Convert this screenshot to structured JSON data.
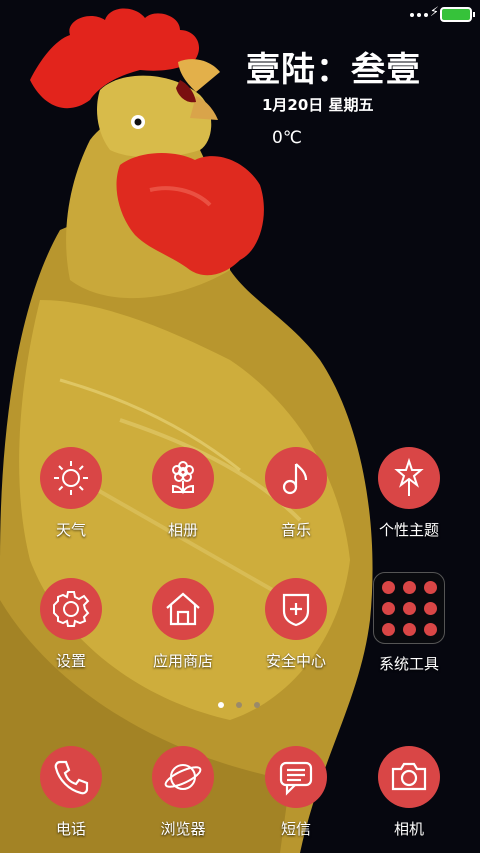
{
  "status_bar": {
    "signal_icon": "signal-dots-icon",
    "charging_icon": "charging-bolt-icon",
    "battery_icon": "battery-icon",
    "battery_color": "#36c23a"
  },
  "clock_widget": {
    "time": "壹陆：叁壹",
    "date": "1月20日  星期五",
    "temperature": "0℃"
  },
  "apps_row1": [
    {
      "label": "天气",
      "icon": "sun-icon"
    },
    {
      "label": "相册",
      "icon": "flower-icon"
    },
    {
      "label": "音乐",
      "icon": "music-note-icon"
    },
    {
      "label": "个性主题",
      "icon": "star-wand-icon"
    }
  ],
  "apps_row2": [
    {
      "label": "设置",
      "icon": "gear-icon"
    },
    {
      "label": "应用商店",
      "icon": "store-house-icon"
    },
    {
      "label": "安全中心",
      "icon": "shield-plus-icon"
    },
    {
      "label": "系统工具",
      "icon": "folder-icon"
    }
  ],
  "pager": {
    "pages": 3,
    "current": 1
  },
  "dock": [
    {
      "label": "电话",
      "icon": "phone-icon"
    },
    {
      "label": "浏览器",
      "icon": "planet-browser-icon"
    },
    {
      "label": "短信",
      "icon": "message-icon"
    },
    {
      "label": "相机",
      "icon": "camera-icon"
    }
  ],
  "colors": {
    "icon_background": "#d94646",
    "background": "#06070f"
  }
}
